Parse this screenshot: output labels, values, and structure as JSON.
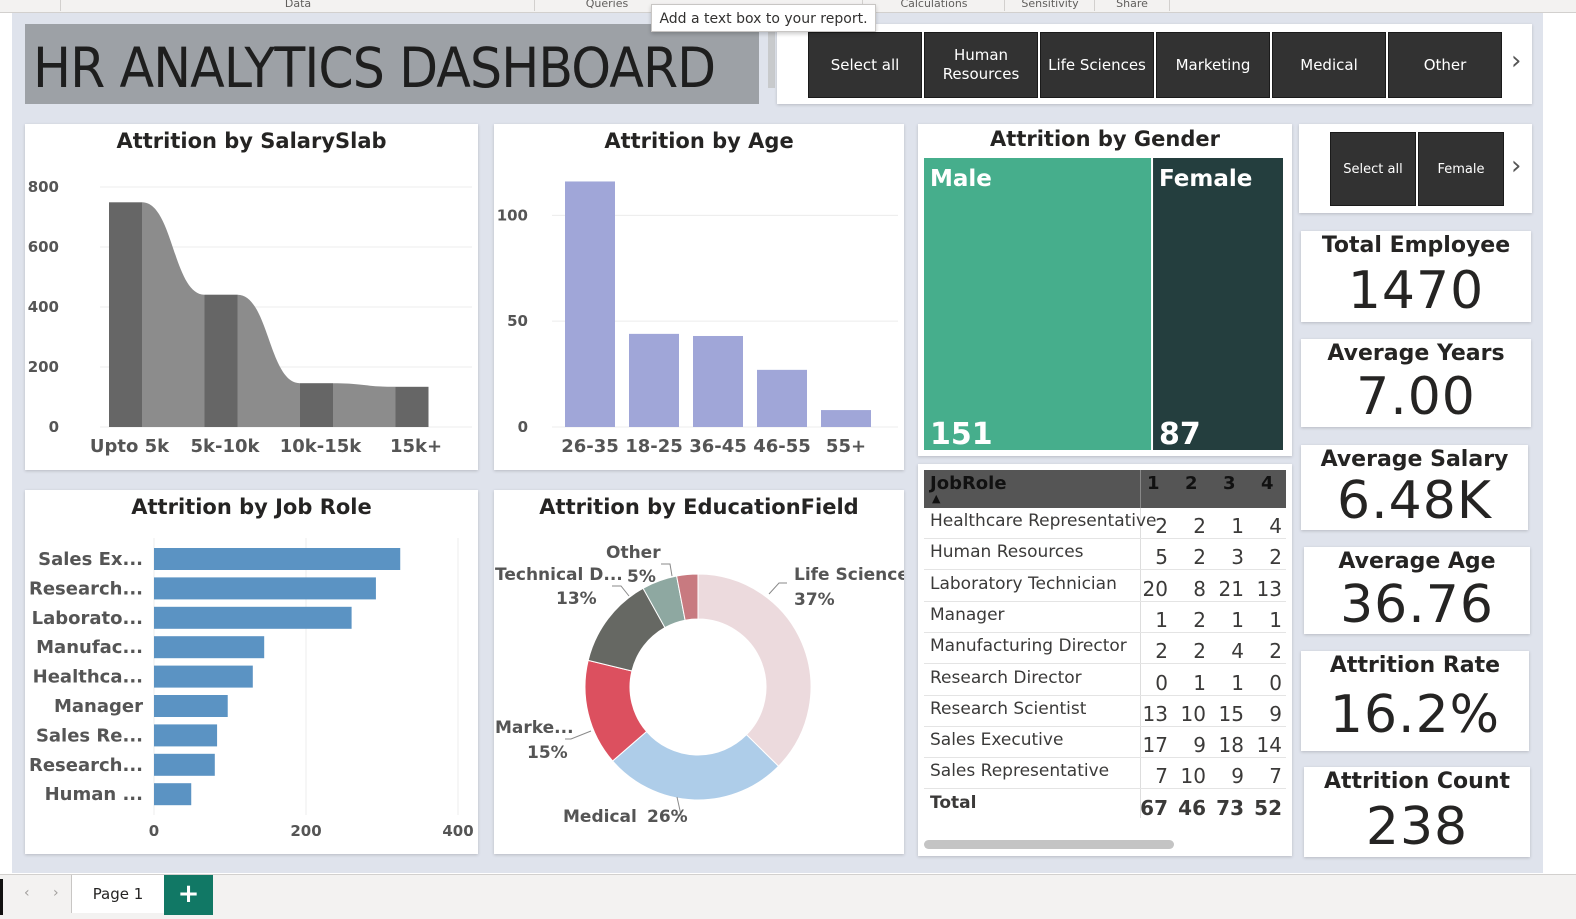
{
  "ribbon": {
    "tabs": [
      "Data",
      "Queries",
      "Calculations",
      "Sensitivity",
      "Share"
    ]
  },
  "tooltip": "Add a text box to your report.",
  "dashboard_title": "HR ANALYTICS DASHBOARD",
  "education_slicer": {
    "buttons": [
      "Select all",
      "Human Resources",
      "Life Sciences",
      "Marketing",
      "Medical",
      "Other"
    ]
  },
  "gender_slicer": {
    "buttons": [
      "Select all",
      "Female"
    ]
  },
  "kpis": [
    {
      "label": "Total Employee",
      "value": "1470"
    },
    {
      "label": "Average Years",
      "value": "7.00"
    },
    {
      "label": "Average Salary",
      "value": "6.48K"
    },
    {
      "label": "Average Age",
      "value": "36.76"
    },
    {
      "label": "Attrition Rate",
      "value": "16.2%"
    },
    {
      "label": "Attrition Count",
      "value": "238"
    }
  ],
  "salary_chart": {
    "title": "Attrition by SalarySlab",
    "chart_data": {
      "type": "bar",
      "categories": [
        "Upto 5k",
        "5k-10k",
        "10k-15k",
        "15k+"
      ],
      "values": [
        749,
        441,
        146,
        134
      ],
      "ylim": [
        0,
        800
      ],
      "yticks": [
        "0",
        "200",
        "400",
        "600",
        "800"
      ],
      "bar_color": "#666666",
      "ribbon_color": "#8c8c8c"
    }
  },
  "age_chart": {
    "title": "Attrition by Age",
    "chart_data": {
      "type": "bar",
      "categories": [
        "26-35",
        "18-25",
        "36-45",
        "46-55",
        "55+"
      ],
      "values": [
        116,
        44,
        43,
        27,
        8
      ],
      "ylim": [
        0,
        120
      ],
      "yticks": [
        "0",
        "50",
        "100"
      ],
      "bar_color": "#a0a6d8"
    }
  },
  "gender_chart": {
    "title": "Attrition by Gender",
    "chart_data": {
      "type": "treemap",
      "labels": [
        "Male",
        "Female"
      ],
      "values": [
        151,
        87
      ],
      "colors": [
        "#46ae8c",
        "#243e3e"
      ]
    }
  },
  "jobrole_chart": {
    "title": "Attrition by Job Role",
    "chart_data": {
      "type": "bar",
      "orientation": "horizontal",
      "categories": [
        "Sales Ex...",
        "Research...",
        "Laborato...",
        "Manufac...",
        "Healthca...",
        "Manager",
        "Sales Re...",
        "Research...",
        "Human ..."
      ],
      "values": [
        324,
        292,
        260,
        145,
        130,
        97,
        83,
        80,
        49
      ],
      "xlim": [
        0,
        400
      ],
      "xticks": [
        "0",
        "200",
        "400"
      ],
      "bar_color": "#5b93c3"
    }
  },
  "education_chart": {
    "title": "Attrition by EducationField",
    "chart_data": {
      "type": "pie",
      "labels": [
        "Life Sciences",
        "Medical",
        "Marketing",
        "Technical Degree",
        "Other",
        "Human Resources"
      ],
      "values": [
        37,
        26,
        15,
        13,
        5,
        3
      ],
      "colors": [
        "#ecdadd",
        "#aecde9",
        "#dc505f",
        "#666863",
        "#8ea8a1",
        "#c87a80"
      ],
      "callouts": [
        {
          "name": "Life Sciences",
          "pct": "37%"
        },
        {
          "name": "Medical",
          "pct": "26%"
        },
        {
          "name": "Marke...",
          "pct": "15%"
        },
        {
          "name": "Technical D...",
          "pct": "13%"
        },
        {
          "name": "Other",
          "pct": "5%"
        }
      ]
    }
  },
  "matrix": {
    "headers": [
      "JobRole",
      "1",
      "2",
      "3",
      "4"
    ],
    "rows": [
      {
        "role": "Healthcare Representative",
        "values": [
          2,
          2,
          1,
          4
        ]
      },
      {
        "role": "Human Resources",
        "values": [
          5,
          2,
          3,
          2
        ]
      },
      {
        "role": "Laboratory Technician",
        "values": [
          20,
          8,
          21,
          13
        ]
      },
      {
        "role": "Manager",
        "values": [
          1,
          2,
          1,
          1
        ]
      },
      {
        "role": "Manufacturing Director",
        "values": [
          2,
          2,
          4,
          2
        ]
      },
      {
        "role": "Research Director",
        "values": [
          0,
          1,
          1,
          0
        ]
      },
      {
        "role": "Research Scientist",
        "values": [
          13,
          10,
          15,
          9
        ]
      },
      {
        "role": "Sales Executive",
        "values": [
          17,
          9,
          18,
          14
        ]
      },
      {
        "role": "Sales Representative",
        "values": [
          7,
          10,
          9,
          7
        ]
      }
    ],
    "total": {
      "label": "Total",
      "values": [
        67,
        46,
        73,
        52
      ]
    }
  },
  "page_tabs": {
    "active": "Page 1",
    "add_label": "+"
  }
}
